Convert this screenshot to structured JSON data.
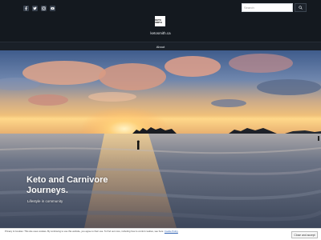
{
  "header": {
    "social_icons": [
      "facebook-icon",
      "twitter-icon",
      "instagram-icon",
      "youtube-icon"
    ],
    "search_placeholder": "Search",
    "logo_text": "KETO SMITH",
    "site_title": "ketosmith.ca"
  },
  "nav": {
    "items": [
      {
        "label": "About"
      }
    ]
  },
  "hero": {
    "title": "Keto and Carnivore Journeys.",
    "subtitle": "Lifestyle in community"
  },
  "cookie": {
    "text": "Privacy & Cookies: This site uses cookies. By continuing to use this website, you agree to their use. To find out more, including how to control cookies, see here:",
    "link_label": "Cookie Policy",
    "button_label": "Close and accept"
  },
  "colors": {
    "header_bg": "#14191f",
    "nav_bg": "#1a2028",
    "sky_top": "#3f5c8c",
    "sun": "#ffd27a"
  }
}
